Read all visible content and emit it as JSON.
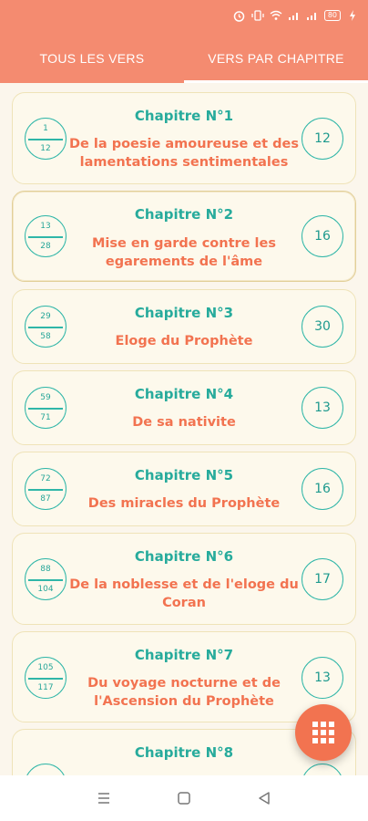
{
  "status": {
    "battery": "80"
  },
  "tabs": [
    {
      "label": "TOUS LES VERS",
      "active": false
    },
    {
      "label": "VERS PAR CHAPITRE",
      "active": true
    }
  ],
  "chapters": [
    {
      "title": "Chapitre N°1",
      "subtitle": "De la poesie amoureuse et des lamentations sentimentales",
      "from": "1",
      "to": "12",
      "count": "12"
    },
    {
      "title": "Chapitre N°2",
      "subtitle": "Mise en garde contre les egarements de l'âme",
      "from": "13",
      "to": "28",
      "count": "16"
    },
    {
      "title": "Chapitre N°3",
      "subtitle": "Eloge du Prophète",
      "from": "29",
      "to": "58",
      "count": "30"
    },
    {
      "title": "Chapitre N°4",
      "subtitle": "De sa nativite",
      "from": "59",
      "to": "71",
      "count": "13"
    },
    {
      "title": "Chapitre N°5",
      "subtitle": "Des miracles du Prophète",
      "from": "72",
      "to": "87",
      "count": "16"
    },
    {
      "title": "Chapitre N°6",
      "subtitle": "De la noblesse et de l'eloge du Coran",
      "from": "88",
      "to": "104",
      "count": "17"
    },
    {
      "title": "Chapitre N°7",
      "subtitle": "Du voyage nocturne et de l'Ascension du Prophète",
      "from": "105",
      "to": "117",
      "count": "13"
    },
    {
      "title": "Chapitre N°8",
      "subtitle": "",
      "from": "",
      "to": "",
      "count": ""
    }
  ],
  "colors": {
    "accent": "#f48b70",
    "teal": "#2fb6a8",
    "coral": "#f27350",
    "background": "#fbf6ec"
  }
}
